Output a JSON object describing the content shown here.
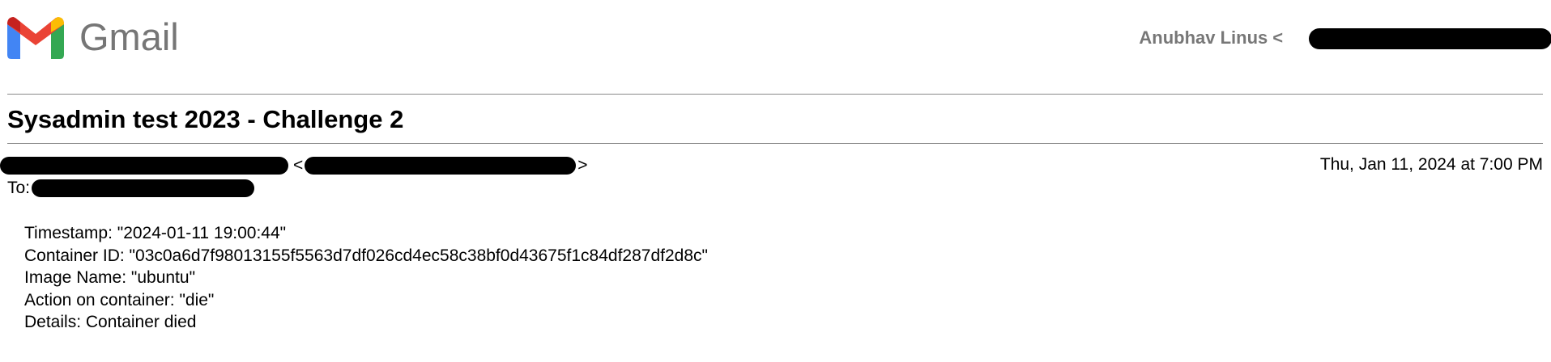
{
  "brand": {
    "name": "Gmail",
    "colors": {
      "blue": "#4285F4",
      "red": "#EA4335",
      "yellow": "#FBBC04",
      "green": "#34A853",
      "wordmark": "#767676"
    }
  },
  "account": {
    "name": "Anubhav Linus",
    "open_bracket": "<",
    "close_bracket": ">"
  },
  "message": {
    "subject": "Sysadmin test 2023 - Challenge 2",
    "from_open_bracket": "<",
    "from_close_bracket": ">",
    "date": "Thu, Jan 11, 2024 at 7:00 PM",
    "to_label": "To:",
    "body": [
      "Timestamp: \"2024-01-11 19:00:44\"",
      "Container ID: \"03c0a6d7f98013155f5563d7df026cd4ec58c38bf0d43675f1c84df287df2d8c\"",
      "Image Name: \"ubuntu\"",
      "Action on container: \"die\"",
      "Details: Container died"
    ]
  }
}
